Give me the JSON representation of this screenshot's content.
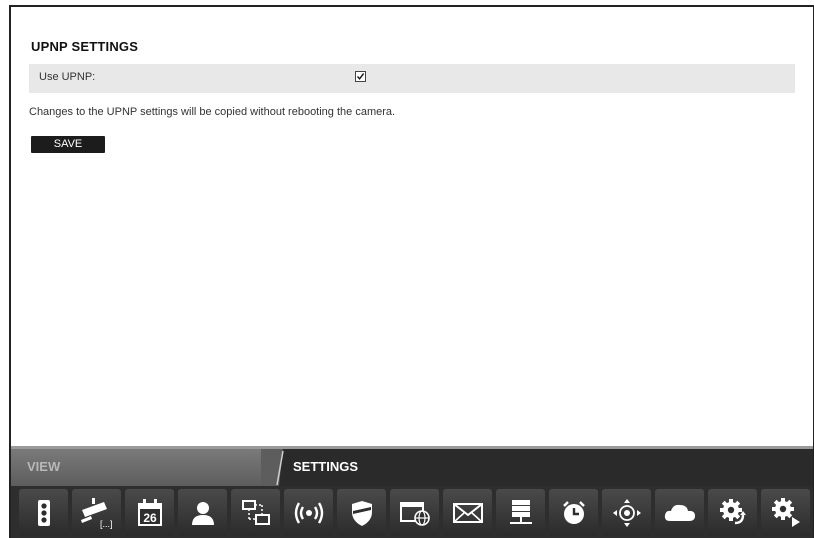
{
  "settings": {
    "title": "UPNP SETTINGS",
    "use_upnp_label": "Use UPNP:",
    "use_upnp_checked": true,
    "note": "Changes to the UPNP settings will be copied without rebooting the camera.",
    "save_label": "SAVE"
  },
  "tabs": {
    "view_label": "VIEW",
    "settings_label": "SETTINGS",
    "active": "SETTINGS"
  },
  "toolbar": {
    "icons": [
      "status-icon",
      "camera-icon",
      "calendar-icon",
      "user-icon",
      "network-icon",
      "wireless-icon",
      "shield-icon",
      "browser-globe-icon",
      "mail-icon",
      "server-icon",
      "clock-icon",
      "ptz-icon",
      "cloud-icon",
      "gear-refresh-icon",
      "gear-play-icon"
    ],
    "calendar_day": "26"
  },
  "colors": {
    "row_background": "#e8e8e8",
    "tab_bar": "#2a2a2a",
    "button": "#1c1c1c"
  }
}
